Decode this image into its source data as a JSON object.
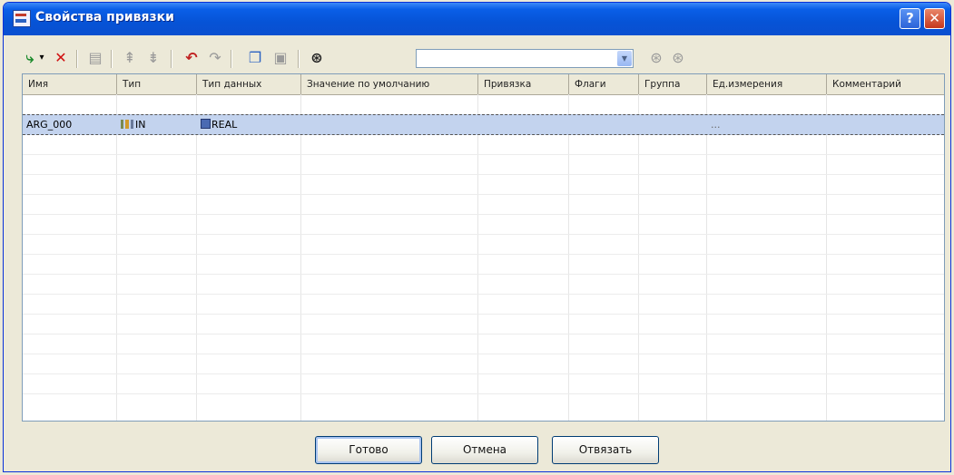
{
  "window": {
    "title": "Свойства привязки",
    "help_label": "?",
    "close_label": "✕"
  },
  "toolbar": {
    "icons": [
      {
        "name": "add-variable-icon",
        "glyph": "⤷",
        "color": "#1a8a2a"
      },
      {
        "name": "dropdown-arrow-icon",
        "glyph": "▾",
        "color": "#333"
      },
      {
        "name": "delete-icon",
        "glyph": "✕",
        "color": "#d01010"
      },
      {
        "name": "properties-icon",
        "glyph": "▤",
        "color": "#9a9a9a"
      },
      {
        "name": "move-up-icon",
        "glyph": "⇞",
        "color": "#9a9a9a"
      },
      {
        "name": "move-down-icon",
        "glyph": "⇟",
        "color": "#9a9a9a"
      },
      {
        "name": "undo-icon",
        "glyph": "↶",
        "color": "#c02020"
      },
      {
        "name": "redo-icon",
        "glyph": "↷",
        "color": "#9a9a9a"
      },
      {
        "name": "copy-icon",
        "glyph": "❐",
        "color": "#2b62c2"
      },
      {
        "name": "paste-icon",
        "glyph": "▣",
        "color": "#9a9a9a"
      },
      {
        "name": "find-icon",
        "glyph": "⊛",
        "color": "#333"
      }
    ],
    "search_value": "",
    "find_next_glyph": "⊛",
    "find_prev_glyph": "⊛"
  },
  "grid": {
    "columns": [
      "Имя",
      "Тип",
      "Тип данных",
      "Значение по умолчанию",
      "Привязка",
      "Флаги",
      "Группа",
      "Ед.измерения",
      "Комментарий"
    ],
    "rows": [
      {
        "name": "ARG_000",
        "type": "IN",
        "data_type": "REAL",
        "default": "",
        "binding": "",
        "flags": "",
        "group": "",
        "unit": "...",
        "comment": ""
      }
    ]
  },
  "buttons": {
    "ok": "Готово",
    "cancel": "Отмена",
    "unbind": "Отвязать"
  },
  "colors": {
    "title_bar": "#0a5fe8",
    "selection": "#c3d3ee",
    "window_bg": "#ece9d8"
  }
}
